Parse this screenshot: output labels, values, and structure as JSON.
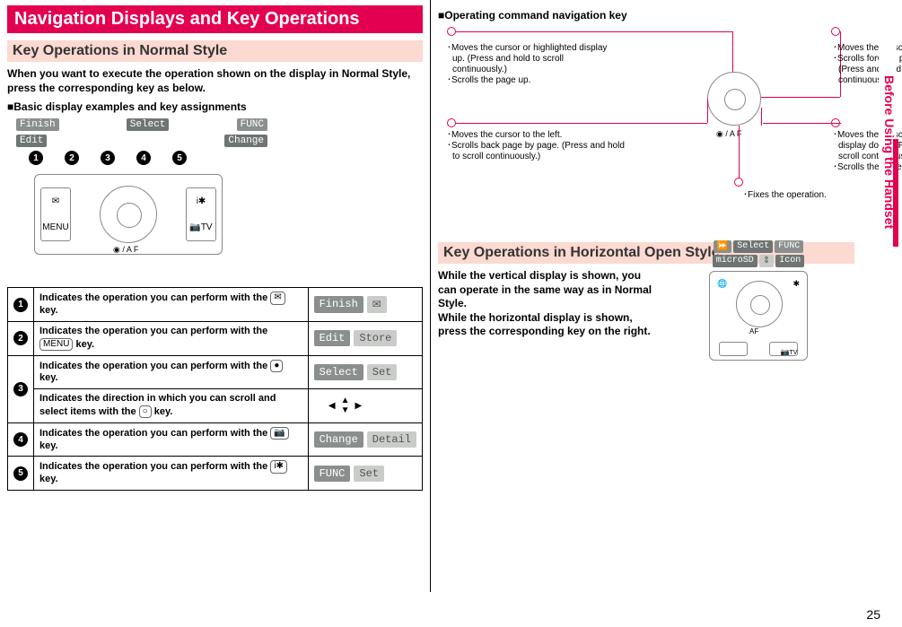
{
  "section_title": "Navigation Displays and Key Operations",
  "side_tab": "Before Using the Handset",
  "page_number": "25",
  "left": {
    "sub1": "Key Operations in Normal Style",
    "intro": "When you want to execute the operation shown on the display in Normal Style, press the corresponding key as below.",
    "heading_basic": "Basic display examples and key assignments",
    "softkeys_top": [
      "Finish",
      "Select",
      "FUNC"
    ],
    "softkeys_bot": [
      "Edit",
      "",
      "Change"
    ],
    "device_left_top": "✉",
    "device_left_bot": "MENU",
    "device_right_top": "i✱",
    "device_right_bot": "📷TV",
    "wheel_label": "◉ / A F",
    "rows": [
      {
        "num": "1",
        "desc": "Indicates the operation you can perform with the",
        "key": "✉",
        "pill1": "Finish",
        "pill2": "✉",
        "p1cls": "",
        "p2cls": "light"
      },
      {
        "num": "2",
        "desc": "Indicates the operation you can perform with the",
        "key": "MENU",
        "pill1": "Edit",
        "pill2": "Store",
        "p1cls": "",
        "p2cls": "light"
      },
      {
        "num": "3a",
        "desc": "Indicates the operation you can perform with the",
        "key": "●",
        "pill1": "Select",
        "pill2": "Set",
        "p1cls": "",
        "p2cls": "light"
      },
      {
        "num": "3b",
        "desc": "Indicates the direction in which you can scroll and select items with the",
        "key": "○",
        "arrows": true
      },
      {
        "num": "4",
        "desc": "Indicates the operation you can perform with the",
        "key": "📷",
        "pill1": "Change",
        "pill2": "Detail",
        "p1cls": "",
        "p2cls": "light"
      },
      {
        "num": "5",
        "desc": "Indicates the operation you can perform with the",
        "key": "i✱",
        "pill1": "FUNC",
        "pill2": "Set",
        "p1cls": "",
        "p2cls": "light"
      }
    ]
  },
  "right": {
    "heading_cmd": "Operating command navigation key",
    "nav_label": "◉ / A F",
    "up": [
      "Moves the cursor or highlighted display up. (Press and hold to scroll continuously.)",
      "Scrolls the page up."
    ],
    "left_txt": [
      "Moves the cursor to the left.",
      "Scrolls back page by page. (Press and hold to scroll continuously.)"
    ],
    "center": [
      "Fixes the operation."
    ],
    "right_txt": [
      "Moves the cursor to the right.",
      "Scrolls forward page by page. (Press and hold to scroll continuously.)"
    ],
    "down": [
      "Moves the cursor or highlighted display down. (Press and hold to scroll continuously.)",
      "Scrolls the page down."
    ],
    "sub2": "Key Operations in Horizontal Open Style",
    "horiz_body": "While the vertical display is shown, you can operate in the same way as in Normal Style.\nWhile the horizontal display is shown, press the corresponding key on the right.",
    "h_soft": [
      "⏩",
      "Select",
      "FUNC"
    ],
    "h_soft2": [
      "microSD",
      "⇕",
      "Icon"
    ],
    "h_af": "AF",
    "h_tv": "TV"
  }
}
